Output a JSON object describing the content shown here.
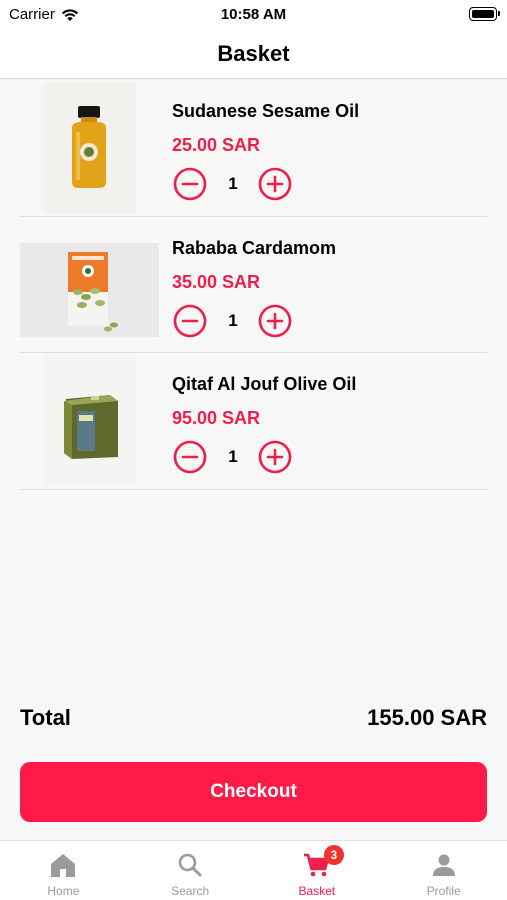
{
  "status_bar": {
    "carrier": "Carrier",
    "time": "10:58 AM"
  },
  "header": {
    "title": "Basket"
  },
  "basket": {
    "items": [
      {
        "name": "Sudanese Sesame Oil",
        "price": "25.00 SAR",
        "quantity": "1"
      },
      {
        "name": "Rababa Cardamom",
        "price": "35.00 SAR",
        "quantity": "1"
      },
      {
        "name": "Qitaf Al Jouf Olive Oil",
        "price": "95.00 SAR",
        "quantity": "1"
      }
    ]
  },
  "summary": {
    "total_label": "Total",
    "total_value": "155.00 SAR"
  },
  "checkout": {
    "label": "Checkout"
  },
  "tabs": [
    {
      "label": "Home",
      "icon": "home-icon"
    },
    {
      "label": "Search",
      "icon": "search-icon"
    },
    {
      "label": "Basket",
      "icon": "cart-icon",
      "badge": "3"
    },
    {
      "label": "Profile",
      "icon": "person-icon"
    }
  ],
  "colors": {
    "accent": "#ff1a47",
    "price": "#ee1f4a",
    "inactive_tab": "#9a9a9a"
  }
}
